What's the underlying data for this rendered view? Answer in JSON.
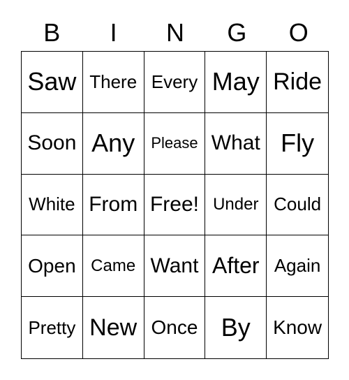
{
  "header": [
    "B",
    "I",
    "N",
    "G",
    "O"
  ],
  "cells": [
    "Saw",
    "There",
    "Every",
    "May",
    "Ride",
    "Soon",
    "Any",
    "Please",
    "What",
    "Fly",
    "White",
    "From",
    "Free!",
    "Under",
    "Could",
    "Open",
    "Came",
    "Want",
    "After",
    "Again",
    "Pretty",
    "New",
    "Once",
    "By",
    "Know"
  ]
}
